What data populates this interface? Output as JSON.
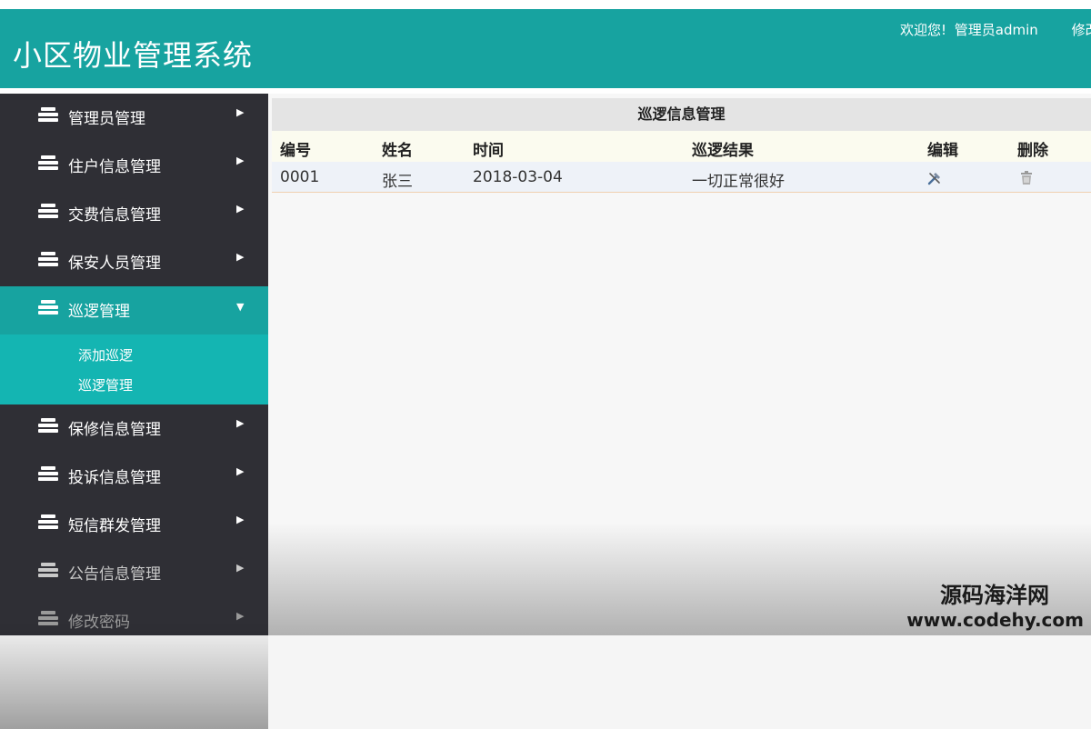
{
  "header": {
    "app_title": "小区物业管理系统",
    "welcome": "欢迎您!",
    "user": "管理员admin",
    "change_link": "修改"
  },
  "sidebar": {
    "items": [
      {
        "label": "管理员管理"
      },
      {
        "label": "住户信息管理"
      },
      {
        "label": "交费信息管理"
      },
      {
        "label": "保安人员管理"
      },
      {
        "label": "巡逻管理",
        "expanded": true,
        "children": [
          {
            "label": "添加巡逻"
          },
          {
            "label": "巡逻管理"
          }
        ]
      },
      {
        "label": "保修信息管理"
      },
      {
        "label": "投诉信息管理"
      },
      {
        "label": "短信群发管理"
      },
      {
        "label": "公告信息管理"
      },
      {
        "label": "修改密码"
      }
    ]
  },
  "main": {
    "panel_title": "巡逻信息管理",
    "columns": [
      "编号",
      "姓名",
      "时间",
      "巡逻结果",
      "编辑",
      "删除"
    ],
    "rows": [
      {
        "id": "0001",
        "name": "张三",
        "time": "2018-03-04",
        "result": "一切正常很好"
      }
    ]
  },
  "watermark": {
    "name": "源码海洋网",
    "url": "www.codehy.com"
  },
  "colors": {
    "accent": "#17a3a0",
    "submenu": "#14b5b2",
    "sidebar_bg": "#2f2f35"
  }
}
